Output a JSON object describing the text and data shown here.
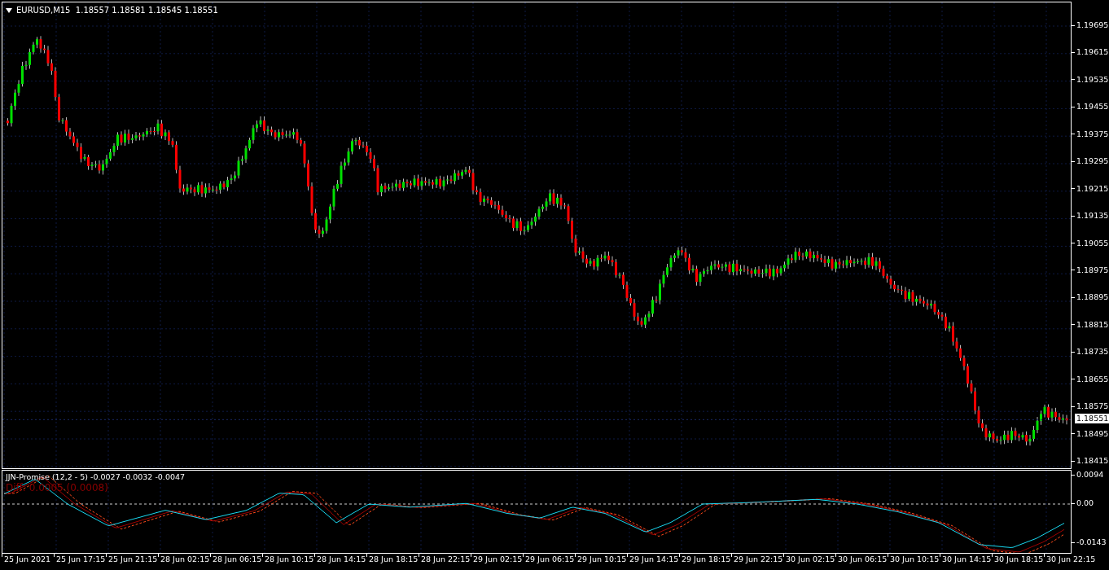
{
  "chart": {
    "header": "EURUSD,M15  1.18557 1.18581 1.18545 1.18551",
    "price_axis": [
      "1.19695",
      "1.19615",
      "1.19535",
      "1.19455",
      "1.19375",
      "1.19295",
      "1.19215",
      "1.19135",
      "1.19055",
      "1.18975",
      "1.18895",
      "1.18815",
      "1.18735",
      "1.18655",
      "1.18575",
      "1.18495",
      "1.18415"
    ],
    "current_price": "1.18551"
  },
  "indicator": {
    "title": "JJN-Promise (12,2 - 5) -0.0027 -0.0032 -0.0047",
    "diff": "Diff: 0.0005 (0.0008)",
    "axis": [
      "0.0094",
      "0.00",
      "-0.0143"
    ]
  },
  "time_axis": [
    "25 Jun 2021",
    "25 Jun 17:15",
    "25 Jun 21:15",
    "28 Jun 02:15",
    "28 Jun 06:15",
    "28 Jun 10:15",
    "28 Jun 14:15",
    "28 Jun 18:15",
    "28 Jun 22:15",
    "29 Jun 02:15",
    "29 Jun 06:15",
    "29 Jun 10:15",
    "29 Jun 14:15",
    "29 Jun 18:15",
    "29 Jun 22:15",
    "30 Jun 02:15",
    "30 Jun 06:15",
    "30 Jun 10:15",
    "30 Jun 14:15",
    "30 Jun 18:15",
    "30 Jun 22:15"
  ]
}
